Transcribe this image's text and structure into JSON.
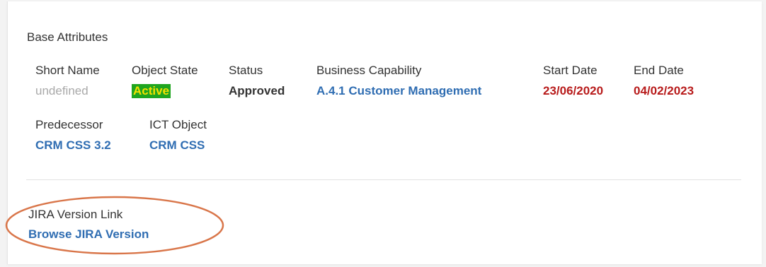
{
  "section": {
    "title": "Base Attributes"
  },
  "attributes": {
    "short_name": {
      "label": "Short Name",
      "value": "undefined"
    },
    "object_state": {
      "label": "Object State",
      "value": "Active"
    },
    "status": {
      "label": "Status",
      "value": "Approved"
    },
    "business_capability": {
      "label": "Business Capability",
      "value": "A.4.1 Customer Management"
    },
    "start_date": {
      "label": "Start Date",
      "value": "23/06/2020"
    },
    "end_date": {
      "label": "End Date",
      "value": "04/02/2023"
    },
    "predecessor": {
      "label": "Predecessor",
      "value": "CRM CSS 3.2"
    },
    "ict_object": {
      "label": "ICT Object",
      "value": "CRM CSS"
    }
  },
  "jira": {
    "label": "JIRA Version Link",
    "link_text": "Browse JIRA Version"
  },
  "colors": {
    "link": "#2f6db2",
    "date": "#b81c1c",
    "state_bg": "#1fa51f",
    "state_text": "#f4e200",
    "annotation": "#d9764a"
  }
}
